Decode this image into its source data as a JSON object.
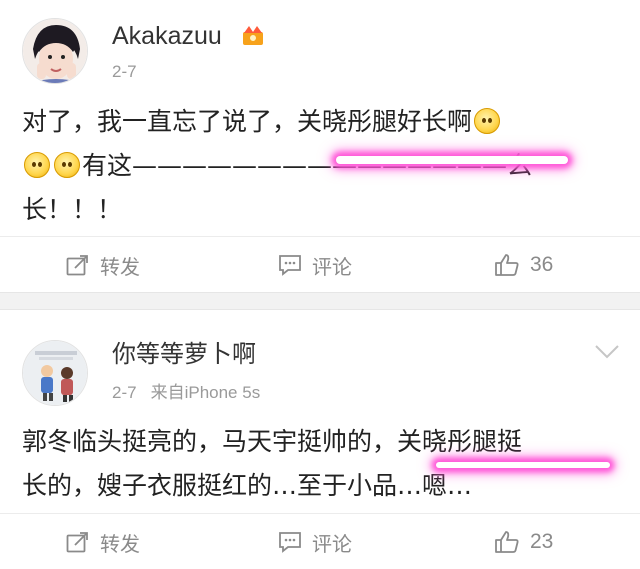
{
  "posts": [
    {
      "username": "Akakazuu",
      "date": "2-7",
      "source": "",
      "text_line1": "对了，我一直忘了说了，关晓彤腿好长啊",
      "text_line2_a": "有这——————",
      "text_line2_b": "—————————",
      "text_line2_c": "么",
      "text_line3": "长！！！",
      "actions": {
        "repost": "转发",
        "comment": "评论",
        "likes": "36"
      }
    },
    {
      "username": "你等等萝卜啊",
      "date": "2-7",
      "source": "来自iPhone 5s",
      "text_line1_a": "郭冬临头挺亮的，马天宇挺帅的，",
      "text_line1_b": "关晓彤腿挺",
      "text_line2_a": "长的",
      "text_line2_b": "，嫂子衣服挺红的…至于小品…嗯…",
      "actions": {
        "repost": "转发",
        "comment": "评论",
        "likes": "23"
      }
    }
  ],
  "colors": {
    "highlight": "#ff56d8",
    "muted": "#8a8a8a",
    "divider": "#f2f2f2"
  },
  "icons": [
    "badge-icon",
    "chevron-down-icon",
    "repost-icon",
    "comment-icon",
    "like-icon",
    "emoji-icon"
  ]
}
